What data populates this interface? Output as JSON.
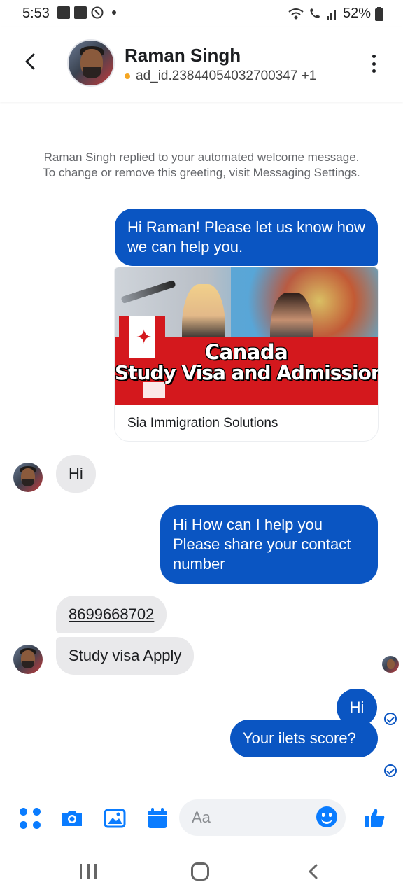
{
  "status_bar": {
    "time": "5:53",
    "battery": "52%"
  },
  "header": {
    "name": "Raman Singh",
    "subtitle": "ad_id.23844054032700347 +1"
  },
  "notice": "Raman Singh replied to your automated welcome message. To change or remove this greeting, visit Messaging Settings.",
  "messages": [
    {
      "from": "me",
      "text": "Hi Raman! Please let us know how we can help you."
    },
    {
      "from": "me",
      "type": "link_card",
      "banner_line1": "Canada",
      "banner_line2": "Study Visa and Admissions",
      "caption": "Sia Immigration Solutions"
    },
    {
      "from": "contact",
      "text": "Hi"
    },
    {
      "from": "me",
      "text": "Hi How can I help you Please share your contact number"
    },
    {
      "from": "contact",
      "text": "8699668702"
    },
    {
      "from": "contact",
      "text": "Study visa Apply"
    },
    {
      "from": "me",
      "text": "Hi"
    },
    {
      "from": "me",
      "text": "Your ilets score?"
    }
  ],
  "composer": {
    "placeholder": "Aa"
  },
  "colors": {
    "outgoing_bubble": "#0a55c2",
    "incoming_bubble": "#e9e9eb",
    "accent": "#0a7cff",
    "banner_red": "#d4181d"
  }
}
